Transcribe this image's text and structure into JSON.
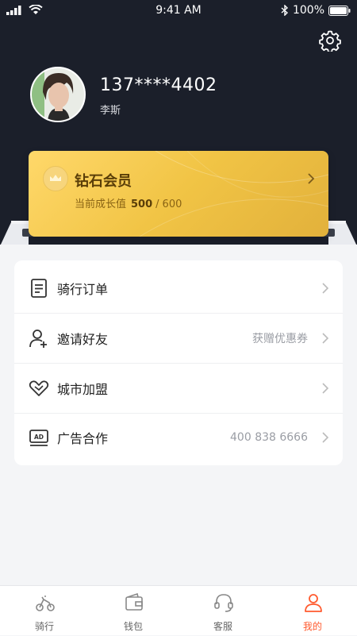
{
  "status_bar": {
    "time": "9:41 AM",
    "battery": "100%"
  },
  "profile": {
    "phone": "137****4402",
    "name": "李斯"
  },
  "membership": {
    "tier": "钻石会员",
    "growth_label": "当前成长值",
    "growth_current": "500",
    "growth_separator": "/",
    "growth_target": "600"
  },
  "menu": [
    {
      "label": "骑行订单",
      "value": "",
      "icon": "order-list-icon"
    },
    {
      "label": "邀请好友",
      "value": "获赠优惠券",
      "icon": "add-friend-icon"
    },
    {
      "label": "城市加盟",
      "value": "",
      "icon": "handshake-heart-icon"
    },
    {
      "label": "广告合作",
      "value": "400 838 6666",
      "icon": "ad-icon"
    }
  ],
  "tabs": [
    {
      "label": "骑行",
      "icon": "scooter-icon",
      "active": false
    },
    {
      "label": "钱包",
      "icon": "wallet-icon",
      "active": false
    },
    {
      "label": "客服",
      "icon": "headset-icon",
      "active": false
    },
    {
      "label": "我的",
      "icon": "user-icon",
      "active": true
    }
  ],
  "colors": {
    "header_bg": "#1b1f2a",
    "accent": "#ff5a2e",
    "gold": "#f1c445"
  }
}
